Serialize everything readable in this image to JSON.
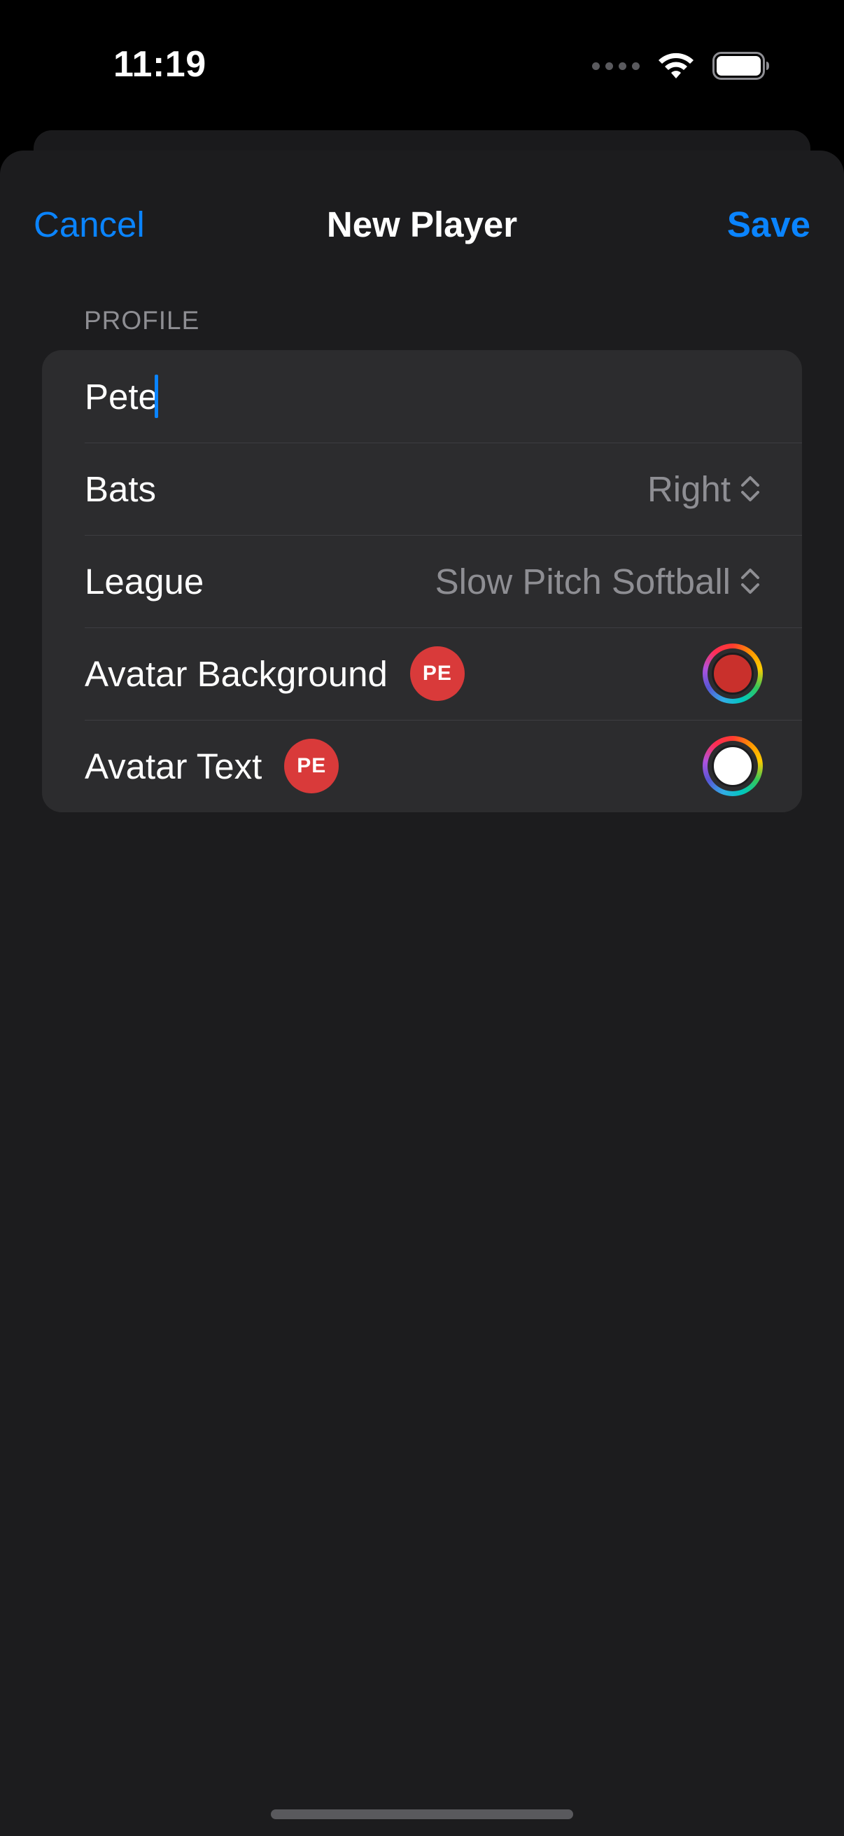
{
  "status_bar": {
    "time": "11:19"
  },
  "nav": {
    "cancel_label": "Cancel",
    "title": "New Player",
    "save_label": "Save"
  },
  "profile": {
    "section_header": "PROFILE",
    "name_value": "Pete",
    "bats": {
      "label": "Bats",
      "value": "Right"
    },
    "league": {
      "label": "League",
      "value": "Slow Pitch Softball"
    },
    "avatar_background": {
      "label": "Avatar Background",
      "initials": "PE",
      "color": "#c9302c"
    },
    "avatar_text": {
      "label": "Avatar Text",
      "initials": "PE",
      "color": "#ffffff"
    }
  },
  "colors": {
    "accent": "#0a84ff",
    "avatar_bg": "#d93a3a"
  }
}
